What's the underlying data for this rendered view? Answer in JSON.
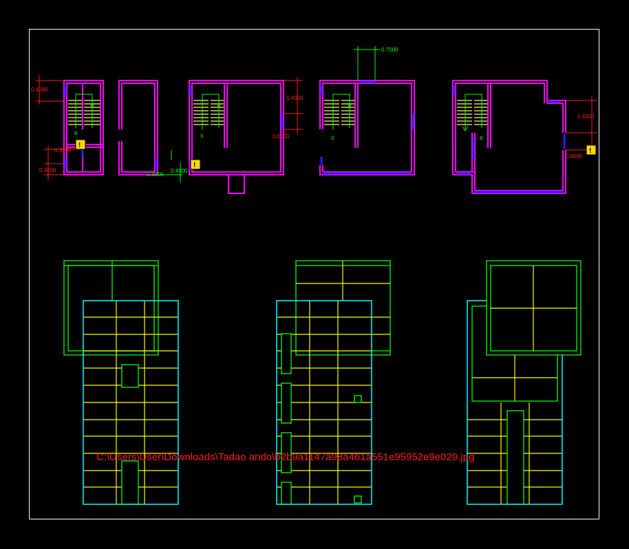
{
  "drawing": {
    "file_path": "C:\\Users\\User\\Downloads\\Tadao ando\\b2b9a1147a98a461a551e95952e9e029.jpg",
    "colors": {
      "background": "#000000",
      "frame": "#ffffff",
      "walls": "#ff00ff",
      "openings": "#2222ff",
      "dimensions": "#ff1a1a",
      "stairs": "#ffff66",
      "annotation": "#00ff00",
      "roof_outline": "#00ffff",
      "roof_grid": "#ffff00",
      "roof_green": "#00ff00",
      "warning": "#ffd700"
    },
    "dimensions": {
      "d1": "0.4000",
      "d2": "0.3000",
      "d3": "0.4000",
      "d4": "0.3000",
      "d5": "0.4000",
      "d6": "1.4000",
      "d7": "0.8000",
      "d8": "0.7000",
      "d9": "1.4000",
      "d10": "0.8000"
    },
    "stair_labels": {
      "p1_b": "B",
      "p1_s": "S",
      "p3_s": "S",
      "p4_s": "S",
      "p5_b": "B"
    },
    "warning_icons": {
      "w1": "!",
      "w2": "!",
      "w3": "!"
    }
  }
}
